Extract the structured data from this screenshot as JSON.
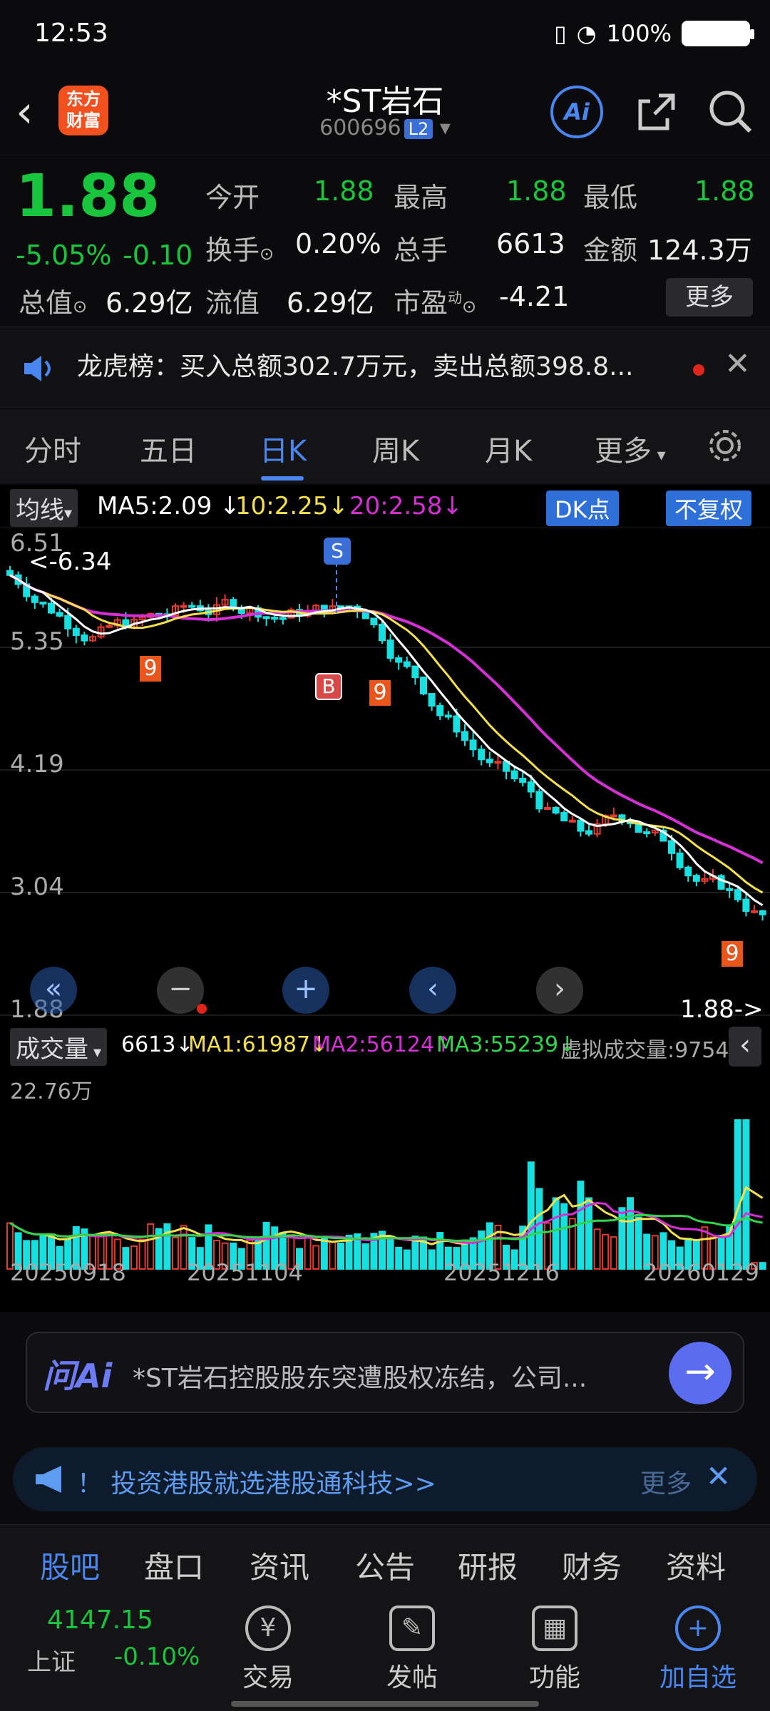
{
  "status_bar": {
    "time": "12:53",
    "battery": "100%"
  },
  "header": {
    "back_icon": "back-arrow-icon",
    "logo_text": "东方\n财富",
    "stock_name": "*ST岩石",
    "stock_code": "600696",
    "level_badge": "L2",
    "ai_label": "Ai"
  },
  "quote": {
    "price": "1.88",
    "change_pct": "-5.05%",
    "change": "-0.10",
    "open_label": "今开",
    "open": "1.88",
    "high_label": "最高",
    "high": "1.88",
    "low_label": "最低",
    "low": "1.88",
    "turnover_label": "换手",
    "turnover": "0.20%",
    "volume_label": "总手",
    "volume": "6613",
    "amount_label": "金额",
    "amount": "124.3万",
    "mktcap_label": "总值",
    "mktcap": "6.29亿",
    "float_label": "流值",
    "float": "6.29亿",
    "pe_label": "市盈",
    "pe_sup": "动",
    "pe": "-4.21",
    "more_label": "更多"
  },
  "news": {
    "text": "龙虎榜：买入总额302.7万元，卖出总额398.8..."
  },
  "tabs": [
    {
      "label": "分时"
    },
    {
      "label": "五日"
    },
    {
      "label": "日K"
    },
    {
      "label": "周K"
    },
    {
      "label": "月K"
    },
    {
      "label": "更多"
    }
  ],
  "chart": {
    "ma_selector": "均线",
    "ma5": "MA5:2.09",
    "ma10": "10:2.25",
    "ma20": "20:2.58",
    "dk_label": "DK点",
    "adjust_label": "不复权",
    "price_levels": [
      "6.51",
      "5.35",
      "4.19",
      "3.04",
      "1.88"
    ],
    "high_marker": "6.34",
    "last_marker": "1.88",
    "s_marker": "S",
    "b_marker": "B",
    "volume_selector": "成交量",
    "vol_now": "6613",
    "vol_ma1": "MA1:61987",
    "vol_ma2": "MA2:56124",
    "vol_ma3": "MA3:55239",
    "vol_virtual": "虚拟成交量:9754",
    "vol_max": "22.76万",
    "dates": [
      "20250918",
      "20251104",
      "20251216",
      "20260129"
    ],
    "colors": {
      "up": "#e23a2f",
      "down": "#19e0e0",
      "ma5": "#ffffff",
      "ma10": "#f5e04a",
      "ma20": "#d62fd6"
    }
  },
  "ask": {
    "logo": "问Ai",
    "text": "*ST岩石控股股东突遭股权冻结，公司..."
  },
  "promo": {
    "text": "！ 投资港股就选港股通科技>>",
    "more": "更多"
  },
  "sub_tabs": [
    {
      "label": "股吧"
    },
    {
      "label": "盘口"
    },
    {
      "label": "资讯"
    },
    {
      "label": "公告"
    },
    {
      "label": "研报"
    },
    {
      "label": "财务"
    },
    {
      "label": "资料"
    }
  ],
  "bottom_nav": {
    "index_value": "4147.15",
    "index_name": "上证",
    "index_change": "-0.10%",
    "items": [
      {
        "label": "交易"
      },
      {
        "label": "发帖"
      },
      {
        "label": "功能"
      },
      {
        "label": "加自选"
      }
    ]
  }
}
